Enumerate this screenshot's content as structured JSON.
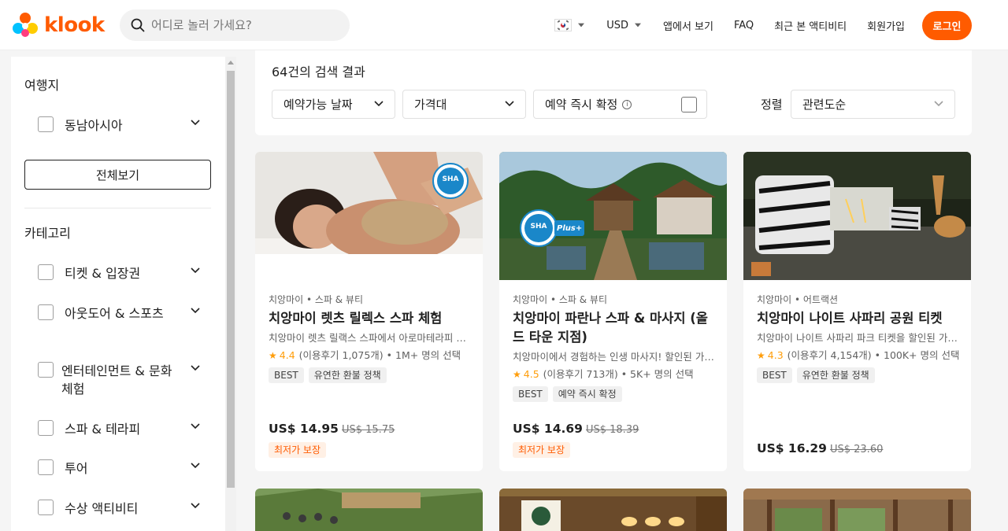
{
  "header": {
    "logo_text": "klook",
    "search_placeholder": "어디로 놀러 가세요?",
    "currency": "USD",
    "nav": [
      "앱에서 보기",
      "FAQ",
      "최근 본 액티비티",
      "회원가입"
    ],
    "login": "로그인",
    "brand_color": "#ff5b00"
  },
  "sidebar": {
    "destination_title": "여행지",
    "destinations": [
      {
        "label": "동남아시아"
      }
    ],
    "view_all": "전체보기",
    "category_title": "카테고리",
    "categories": [
      {
        "label": "티켓 & 입장권"
      },
      {
        "label": "아웃도어 & 스포츠"
      },
      {
        "label": "엔터테인먼트 & 문화체험"
      },
      {
        "label": "스파 & 테라피"
      },
      {
        "label": "투어"
      },
      {
        "label": "수상 액티비티"
      }
    ]
  },
  "results": {
    "count_text": "64건의 검색 결과",
    "filters": {
      "date": "예약가능 날짜",
      "price": "가격대",
      "instant": "예약 즉시 확정"
    },
    "sort_label": "정렬",
    "sort_value": "관련도순"
  },
  "cards": [
    {
      "category": "치앙마이 • 스파 & 뷰티",
      "title": "치앙마이 렛츠 릴렉스 스파 체험",
      "desc": "치앙마이 렛츠 릴랙스 스파에서 아로마테라피 마사지",
      "rating": "4.4",
      "reviews": "(이용후기 1,075개) • 1M+ 명의 선택",
      "tags": [
        "BEST",
        "유연한 환불 정책"
      ],
      "price": "US$ 14.95",
      "old_price": "US$ 15.75",
      "badge": "최저가 보장",
      "image_badge": "SHA"
    },
    {
      "category": "치앙마이 • 스파 & 뷰티",
      "title": "치앙마이 파란나 스파 & 마사지 (올드 타운 지점)",
      "desc": "치앙마이에서 경험하는 인생 마사지! 할인된 가격으로 만나보세요",
      "rating": "4.5",
      "reviews": "(이용후기 713개) • 5K+ 명의 선택",
      "tags": [
        "BEST",
        "예약 즉시 확정"
      ],
      "price": "US$ 14.69",
      "old_price": "US$ 18.39",
      "badge": "최저가 보장",
      "image_badge": "SHA",
      "image_badge_plus": "Plus+"
    },
    {
      "category": "치앙마이 • 어트랙션",
      "title": "치앙마이 나이트 사파리 공원 티켓",
      "desc": "치앙마이 나이트 사파리 파크 티켓을 할인된 가격으로 예약하세요",
      "rating": "4.3",
      "reviews": "(이용후기 4,154개) • 100K+ 명의 선택",
      "tags": [
        "BEST",
        "유연한 환불 정책"
      ],
      "price": "US$ 16.29",
      "old_price": "US$ 23.60"
    }
  ]
}
